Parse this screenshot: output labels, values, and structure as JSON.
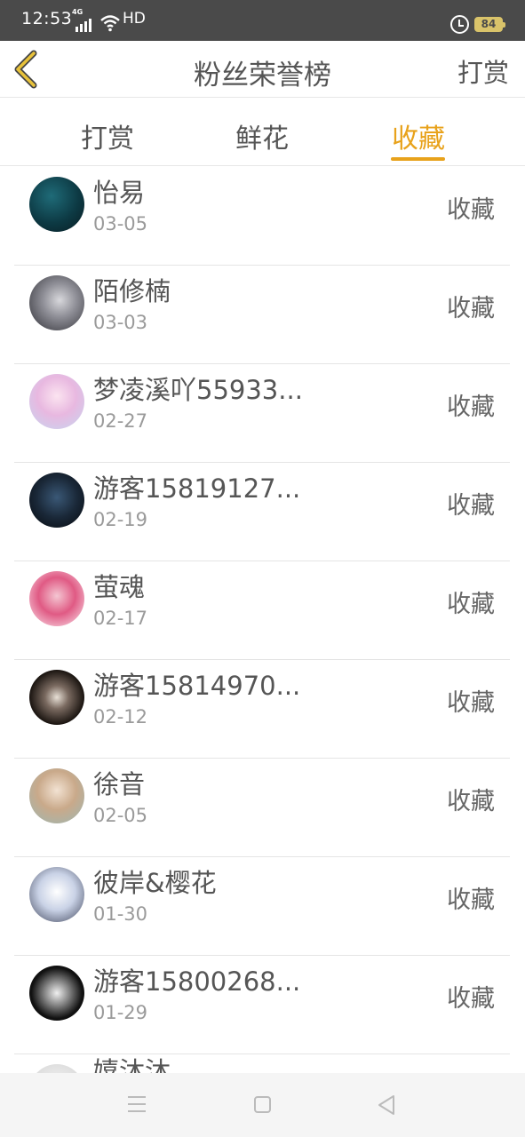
{
  "status_bar": {
    "time": "12:53",
    "network": "4G",
    "hd": "HD",
    "battery": "84",
    "icons": [
      "signal-icon",
      "wifi-icon",
      "alarm-icon",
      "battery-icon"
    ]
  },
  "header": {
    "title": "粉丝荣誉榜",
    "right_label": "打赏",
    "back_icon": "chevron-left-icon"
  },
  "tabs": [
    {
      "label": "打赏",
      "active": false
    },
    {
      "label": "鲜花",
      "active": false
    },
    {
      "label": "收藏",
      "active": true
    }
  ],
  "colors": {
    "accent": "#e8a21b",
    "status_bar": "#4a4a4a",
    "text": "#555555",
    "muted": "#9a9a9a"
  },
  "list": [
    {
      "name": "怡易",
      "date": "03-05",
      "action": "收藏"
    },
    {
      "name": "陌修楠",
      "date": "03-03",
      "action": "收藏"
    },
    {
      "name": "梦凌溪吖55933...",
      "date": "02-27",
      "action": "收藏"
    },
    {
      "name": "游客15819127...",
      "date": "02-19",
      "action": "收藏"
    },
    {
      "name": "萤魂",
      "date": "02-17",
      "action": "收藏"
    },
    {
      "name": "游客15814970...",
      "date": "02-12",
      "action": "收藏"
    },
    {
      "name": "徐音",
      "date": "02-05",
      "action": "收藏"
    },
    {
      "name": "彼岸&樱花",
      "date": "01-30",
      "action": "收藏"
    },
    {
      "name": "游客15800268...",
      "date": "01-29",
      "action": "收藏"
    },
    {
      "name": "嬉沐沐",
      "date": "",
      "action": ""
    }
  ],
  "nav_bar": {
    "icons": [
      "menu-icon",
      "home-icon",
      "back-triangle-icon"
    ]
  }
}
